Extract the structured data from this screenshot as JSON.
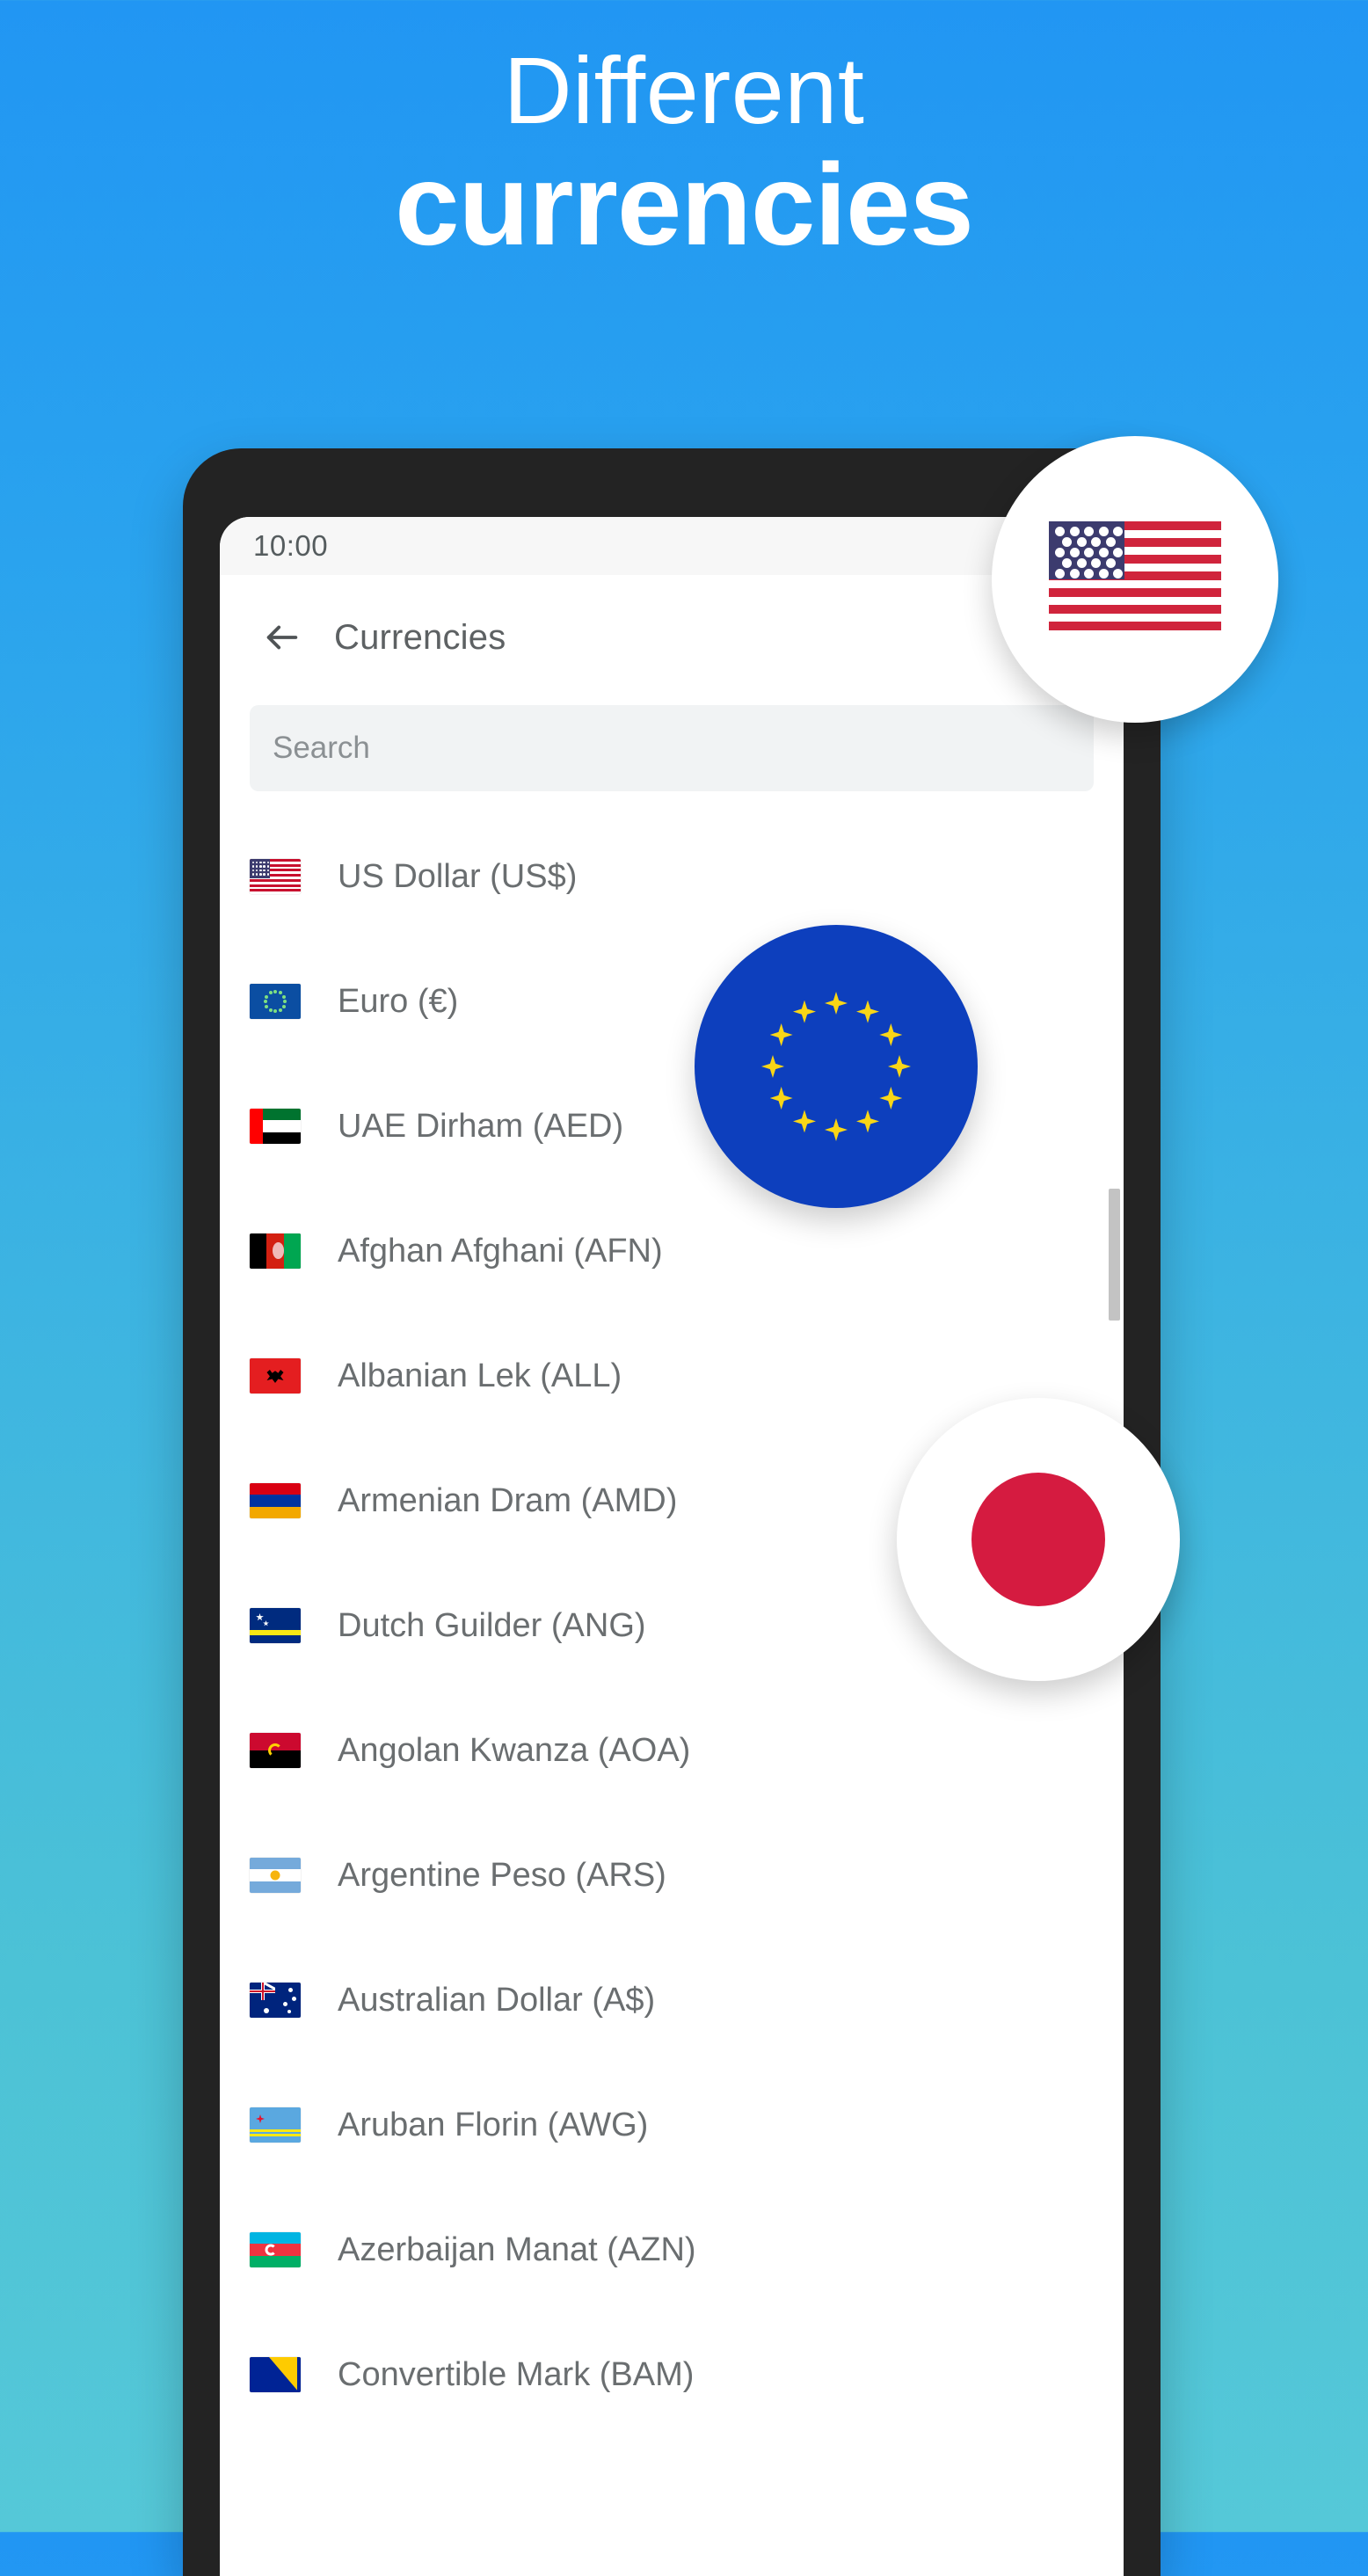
{
  "hero": {
    "line1": "Different",
    "line2": "currencies",
    "text_color": "#ffffff",
    "background_top": "#2196f3",
    "background_bottom": "#55c8d8"
  },
  "phone": {
    "status_bar": {
      "time": "10:00",
      "wifi_icon": "wifi-icon"
    },
    "app_bar": {
      "back_icon": "back-arrow-icon",
      "title": "Currencies"
    },
    "search": {
      "placeholder": "Search",
      "value": ""
    },
    "currency_list": [
      {
        "flag": "us",
        "label": "US Dollar (US$)"
      },
      {
        "flag": "eu",
        "label": "Euro (€)"
      },
      {
        "flag": "ae",
        "label": "UAE Dirham (AED)"
      },
      {
        "flag": "af",
        "label": "Afghan Afghani (AFN)"
      },
      {
        "flag": "al",
        "label": "Albanian Lek (ALL)"
      },
      {
        "flag": "am",
        "label": "Armenian Dram (AMD)"
      },
      {
        "flag": "cw",
        "label": "Dutch Guilder (ANG)"
      },
      {
        "flag": "ao",
        "label": "Angolan Kwanza (AOA)"
      },
      {
        "flag": "ar",
        "label": "Argentine Peso (ARS)"
      },
      {
        "flag": "au",
        "label": "Australian Dollar (A$)"
      },
      {
        "flag": "aw",
        "label": "Aruban Florin (AWG)"
      },
      {
        "flag": "az",
        "label": "Azerbaijan Manat (AZN)"
      },
      {
        "flag": "ba",
        "label": "Convertible Mark (BAM)"
      }
    ]
  },
  "badges": [
    {
      "name": "us-flag-badge",
      "accent": "#d0243c"
    },
    {
      "name": "eu-flag-badge",
      "accent": "#0d3fbd"
    },
    {
      "name": "japan-flag-badge",
      "accent": "#d51b40"
    }
  ]
}
